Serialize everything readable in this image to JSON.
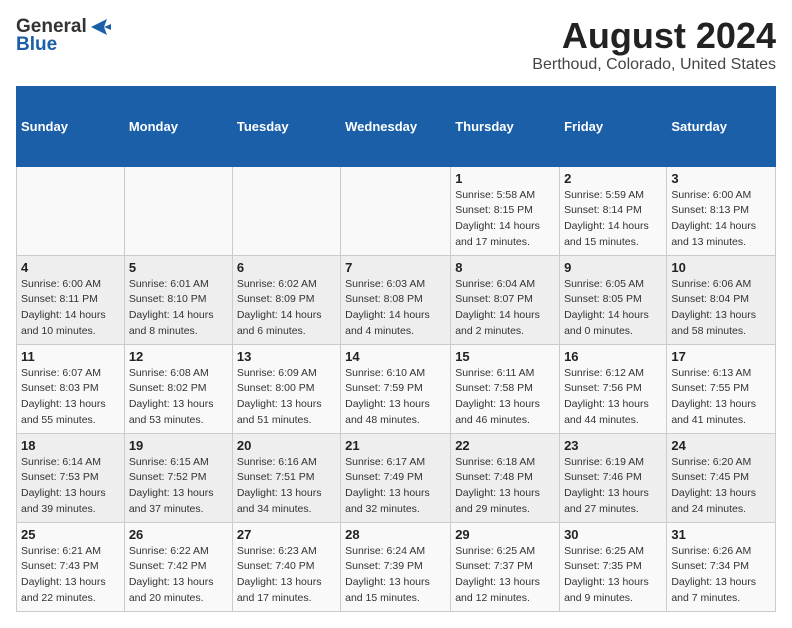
{
  "header": {
    "logo_general": "General",
    "logo_blue": "Blue",
    "main_title": "August 2024",
    "subtitle": "Berthoud, Colorado, United States"
  },
  "calendar": {
    "days_of_week": [
      "Sunday",
      "Monday",
      "Tuesday",
      "Wednesday",
      "Thursday",
      "Friday",
      "Saturday"
    ],
    "weeks": [
      [
        {
          "day": "",
          "info": ""
        },
        {
          "day": "",
          "info": ""
        },
        {
          "day": "",
          "info": ""
        },
        {
          "day": "",
          "info": ""
        },
        {
          "day": "1",
          "info": "Sunrise: 5:58 AM\nSunset: 8:15 PM\nDaylight: 14 hours\nand 17 minutes."
        },
        {
          "day": "2",
          "info": "Sunrise: 5:59 AM\nSunset: 8:14 PM\nDaylight: 14 hours\nand 15 minutes."
        },
        {
          "day": "3",
          "info": "Sunrise: 6:00 AM\nSunset: 8:13 PM\nDaylight: 14 hours\nand 13 minutes."
        }
      ],
      [
        {
          "day": "4",
          "info": "Sunrise: 6:00 AM\nSunset: 8:11 PM\nDaylight: 14 hours\nand 10 minutes."
        },
        {
          "day": "5",
          "info": "Sunrise: 6:01 AM\nSunset: 8:10 PM\nDaylight: 14 hours\nand 8 minutes."
        },
        {
          "day": "6",
          "info": "Sunrise: 6:02 AM\nSunset: 8:09 PM\nDaylight: 14 hours\nand 6 minutes."
        },
        {
          "day": "7",
          "info": "Sunrise: 6:03 AM\nSunset: 8:08 PM\nDaylight: 14 hours\nand 4 minutes."
        },
        {
          "day": "8",
          "info": "Sunrise: 6:04 AM\nSunset: 8:07 PM\nDaylight: 14 hours\nand 2 minutes."
        },
        {
          "day": "9",
          "info": "Sunrise: 6:05 AM\nSunset: 8:05 PM\nDaylight: 14 hours\nand 0 minutes."
        },
        {
          "day": "10",
          "info": "Sunrise: 6:06 AM\nSunset: 8:04 PM\nDaylight: 13 hours\nand 58 minutes."
        }
      ],
      [
        {
          "day": "11",
          "info": "Sunrise: 6:07 AM\nSunset: 8:03 PM\nDaylight: 13 hours\nand 55 minutes."
        },
        {
          "day": "12",
          "info": "Sunrise: 6:08 AM\nSunset: 8:02 PM\nDaylight: 13 hours\nand 53 minutes."
        },
        {
          "day": "13",
          "info": "Sunrise: 6:09 AM\nSunset: 8:00 PM\nDaylight: 13 hours\nand 51 minutes."
        },
        {
          "day": "14",
          "info": "Sunrise: 6:10 AM\nSunset: 7:59 PM\nDaylight: 13 hours\nand 48 minutes."
        },
        {
          "day": "15",
          "info": "Sunrise: 6:11 AM\nSunset: 7:58 PM\nDaylight: 13 hours\nand 46 minutes."
        },
        {
          "day": "16",
          "info": "Sunrise: 6:12 AM\nSunset: 7:56 PM\nDaylight: 13 hours\nand 44 minutes."
        },
        {
          "day": "17",
          "info": "Sunrise: 6:13 AM\nSunset: 7:55 PM\nDaylight: 13 hours\nand 41 minutes."
        }
      ],
      [
        {
          "day": "18",
          "info": "Sunrise: 6:14 AM\nSunset: 7:53 PM\nDaylight: 13 hours\nand 39 minutes."
        },
        {
          "day": "19",
          "info": "Sunrise: 6:15 AM\nSunset: 7:52 PM\nDaylight: 13 hours\nand 37 minutes."
        },
        {
          "day": "20",
          "info": "Sunrise: 6:16 AM\nSunset: 7:51 PM\nDaylight: 13 hours\nand 34 minutes."
        },
        {
          "day": "21",
          "info": "Sunrise: 6:17 AM\nSunset: 7:49 PM\nDaylight: 13 hours\nand 32 minutes."
        },
        {
          "day": "22",
          "info": "Sunrise: 6:18 AM\nSunset: 7:48 PM\nDaylight: 13 hours\nand 29 minutes."
        },
        {
          "day": "23",
          "info": "Sunrise: 6:19 AM\nSunset: 7:46 PM\nDaylight: 13 hours\nand 27 minutes."
        },
        {
          "day": "24",
          "info": "Sunrise: 6:20 AM\nSunset: 7:45 PM\nDaylight: 13 hours\nand 24 minutes."
        }
      ],
      [
        {
          "day": "25",
          "info": "Sunrise: 6:21 AM\nSunset: 7:43 PM\nDaylight: 13 hours\nand 22 minutes."
        },
        {
          "day": "26",
          "info": "Sunrise: 6:22 AM\nSunset: 7:42 PM\nDaylight: 13 hours\nand 20 minutes."
        },
        {
          "day": "27",
          "info": "Sunrise: 6:23 AM\nSunset: 7:40 PM\nDaylight: 13 hours\nand 17 minutes."
        },
        {
          "day": "28",
          "info": "Sunrise: 6:24 AM\nSunset: 7:39 PM\nDaylight: 13 hours\nand 15 minutes."
        },
        {
          "day": "29",
          "info": "Sunrise: 6:25 AM\nSunset: 7:37 PM\nDaylight: 13 hours\nand 12 minutes."
        },
        {
          "day": "30",
          "info": "Sunrise: 6:25 AM\nSunset: 7:35 PM\nDaylight: 13 hours\nand 9 minutes."
        },
        {
          "day": "31",
          "info": "Sunrise: 6:26 AM\nSunset: 7:34 PM\nDaylight: 13 hours\nand 7 minutes."
        }
      ]
    ]
  }
}
